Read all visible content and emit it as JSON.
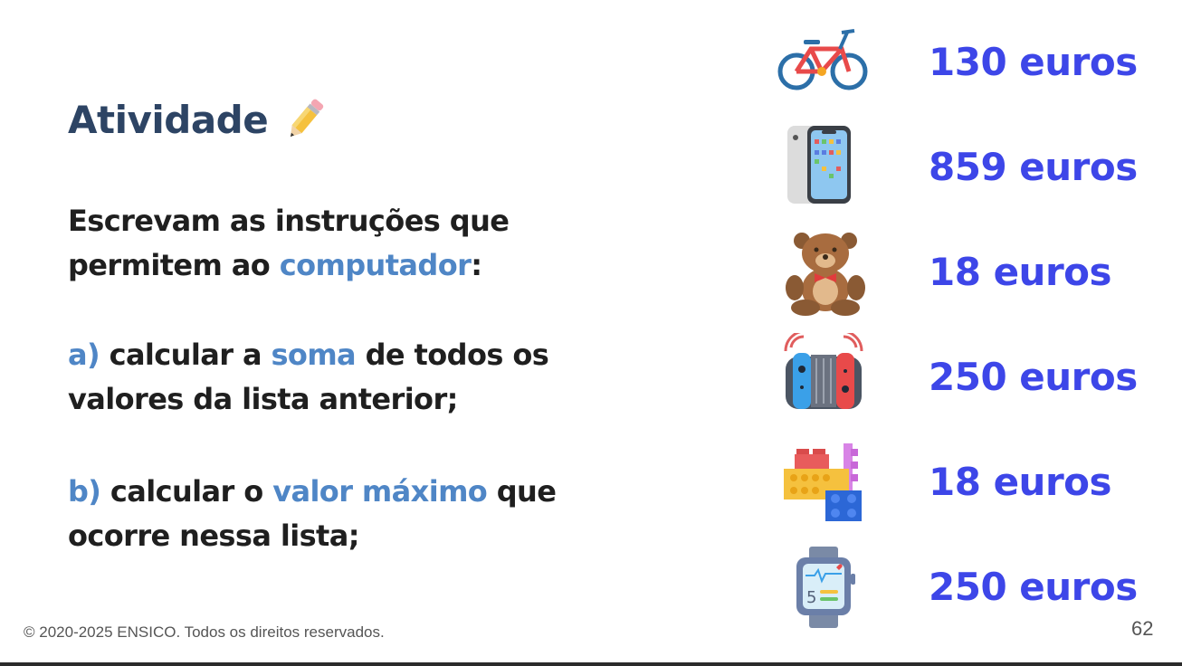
{
  "slide": {
    "title": "Atividade",
    "intro_a": "Escrevam as instruções que",
    "intro_b": "permitem ao ",
    "intro_hl": "computador",
    "intro_end": ":",
    "a_label": "a)",
    "a_text1": " calcular a ",
    "a_hl": "soma",
    "a_text2": " de todos os",
    "a_line2": "valores da lista anterior;",
    "b_label": "b)",
    "b_text1": " calcular o ",
    "b_hl": "valor máximo",
    "b_text2": " que",
    "b_line2": "ocorre nessa lista;",
    "footer": "© 2020-2025 ENSICO. Todos os direitos reservados.",
    "page_number": "62"
  },
  "items": [
    {
      "icon": "bicycle-icon",
      "price": "130 euros"
    },
    {
      "icon": "smartphone-icon",
      "price": "859 euros"
    },
    {
      "icon": "teddy-bear-icon",
      "price": "18 euros"
    },
    {
      "icon": "game-console-icon",
      "price": "250 euros"
    },
    {
      "icon": "lego-blocks-icon",
      "price": "18 euros"
    },
    {
      "icon": "smartwatch-icon",
      "price": "250 euros"
    }
  ],
  "colors": {
    "title": "#2d4464",
    "highlight": "#4f86c6",
    "price": "#3d46e8"
  }
}
